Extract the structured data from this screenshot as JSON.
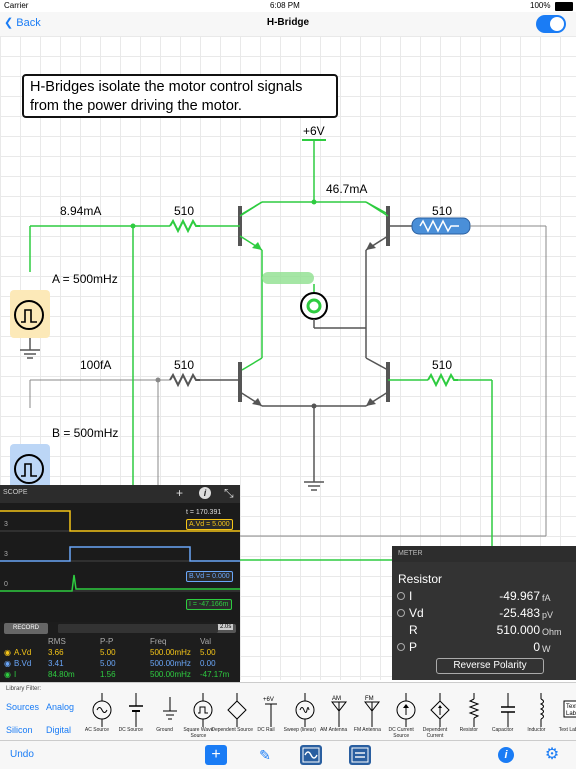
{
  "status_bar": {
    "carrier": "Carrier",
    "time": "6:08 PM",
    "battery": "100%"
  },
  "nav": {
    "back_label": "Back",
    "title": "H-Bridge"
  },
  "note": {
    "line1": "H-Bridges isolate the motor control signals",
    "line2": "from the power driving the motor."
  },
  "circuit": {
    "supply_label": "+6V",
    "top_current": "46.7mA",
    "left_current_a": "8.94mA",
    "left_current_b": "100fA",
    "resistor_top_left": "510",
    "resistor_top_right": "510",
    "resistor_bottom_left": "510",
    "resistor_bottom_right": "510",
    "source_a_label": "A = 500mHz",
    "source_b_label": "B = 500mHz",
    "colors": {
      "wire_active": "#2ecc40",
      "wire_idle": "#888888",
      "source_a": "#fce9b8",
      "source_b": "#bcd6f6",
      "selected_resistor": "#4a8fd8"
    }
  },
  "scope": {
    "title": "SCOPE",
    "add_icon": "+",
    "info_icon": "i",
    "expand_icon": "⤡",
    "time_readout": "t = 170.391",
    "trace_a_tag": "A.Vd = 5.000",
    "trace_b_tag": "B.Vd = 0.000",
    "trace_i_tag": "I = -47.166m",
    "axis_labels": [
      "3",
      "3",
      "3",
      "0"
    ],
    "record_label": "RECORD",
    "zoom_label": "2.0s",
    "record_progress": 0.9,
    "table_headers": [
      "RMS",
      "P-P",
      "Freq",
      "Val"
    ],
    "rows": [
      {
        "name": "A.Vd",
        "rms": "3.66",
        "pp": "5.00",
        "freq": "500.00mHz",
        "val": "5.00",
        "color": "#f5c518"
      },
      {
        "name": "B.Vd",
        "rms": "3.41",
        "pp": "5.00",
        "freq": "500.00mHz",
        "val": "0.00",
        "color": "#6aa6f8"
      },
      {
        "name": "I",
        "rms": "84.80m",
        "pp": "1.56",
        "freq": "500.00mHz",
        "val": "-47.17m",
        "color": "#2ecc40"
      }
    ]
  },
  "meter": {
    "title": "METER",
    "component": "Resistor",
    "rows": [
      {
        "name": "I",
        "value": "-49.967",
        "unit": "fA"
      },
      {
        "name": "Vd",
        "value": "-25.483",
        "unit": "pV"
      },
      {
        "name": "R",
        "value": "510.000",
        "unit": "Ohm"
      },
      {
        "name": "P",
        "value": "0",
        "unit": "W"
      }
    ],
    "reverse_label": "Reverse Polarity"
  },
  "library": {
    "filter_label": "Library Filter:",
    "filters": [
      "Sources",
      "Analog",
      "Silicon",
      "Digital"
    ],
    "parts": [
      {
        "label": "AC Source",
        "icon": "ac-source-icon"
      },
      {
        "label": "DC Source",
        "icon": "dc-source-icon"
      },
      {
        "label": "Ground",
        "icon": "ground-icon"
      },
      {
        "label": "Square Wave Source",
        "icon": "square-wave-icon"
      },
      {
        "label": "Dependent Source",
        "icon": "dependent-source-icon"
      },
      {
        "label": "DC Rail",
        "icon": "dc-rail-icon"
      },
      {
        "label": "Sweep (linear)",
        "icon": "sweep-icon"
      },
      {
        "label": "AM Antenna",
        "icon": "am-antenna-icon"
      },
      {
        "label": "FM Antenna",
        "icon": "fm-antenna-icon"
      },
      {
        "label": "DC Current Source",
        "icon": "current-source-icon"
      },
      {
        "label": "Dependent Current",
        "icon": "dependent-current-icon"
      },
      {
        "label": "Resistor",
        "icon": "resistor-icon"
      },
      {
        "label": "Capacitor",
        "icon": "capacitor-icon"
      },
      {
        "label": "Inductor",
        "icon": "inductor-icon"
      },
      {
        "label": "Text Label",
        "icon": "text-label-icon"
      }
    ],
    "rail_text": "+6V",
    "am_text": "AM",
    "fm_text": "FM",
    "text_icon_text": "Text Label"
  },
  "toolbar": {
    "undo_label": "Undo"
  }
}
